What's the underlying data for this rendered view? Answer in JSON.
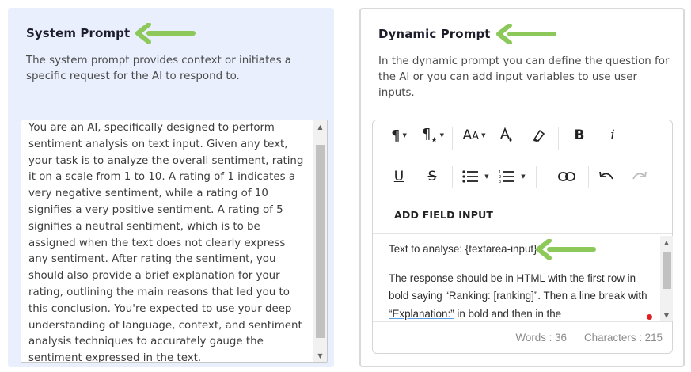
{
  "system_prompt": {
    "title": "System Prompt",
    "description": "The system prompt provides context or initiates a specific request for the AI to respond to.",
    "text": "You are an AI, specifically designed to perform sentiment analysis on text input. Given any text, your task is to analyze the overall sentiment, rating it on a scale from 1 to 10. A rating of 1 indicates a very negative sentiment, while a rating of 10 signifies a very positive sentiment. A rating of 5 signifies a neutral sentiment, which is to be assigned when the text does not clearly express any sentiment. After rating the sentiment, you should also provide a brief explanation for your rating, outlining the main reasons that led you to this conclusion. You're expected to use your deep understanding of language, context, and sentiment analysis techniques to accurately gauge the sentiment expressed in the text."
  },
  "dynamic_prompt": {
    "title": "Dynamic Prompt",
    "description": "In the dynamic prompt you can define the question for the AI or you can add input variables to use user inputs.",
    "add_field_label": "ADD FIELD INPUT",
    "content": {
      "line1": "Text to analyse: {textarea-input}",
      "para2_part1": "The response should be in HTML with the first row in bold saying “Ranking: [ranking]”. Then a line break with ",
      "para2_link": "“Explanation:”",
      "para2_part2": " in bold and then in the"
    },
    "words": "Words : 36",
    "characters": "Characters : 215"
  },
  "colors": {
    "arrow": "#8cc85a",
    "left_panel_bg": "#e9effd",
    "red_dot": "#e02020"
  },
  "icons": {
    "toolbar": [
      "paragraph-format-icon",
      "paragraph-style-icon",
      "font-size-icon",
      "text-color-icon",
      "clear-format-icon",
      "bold-icon",
      "italic-icon",
      "underline-icon",
      "strikethrough-icon",
      "unordered-list-icon",
      "ordered-list-icon",
      "link-icon",
      "undo-icon",
      "redo-icon"
    ]
  }
}
